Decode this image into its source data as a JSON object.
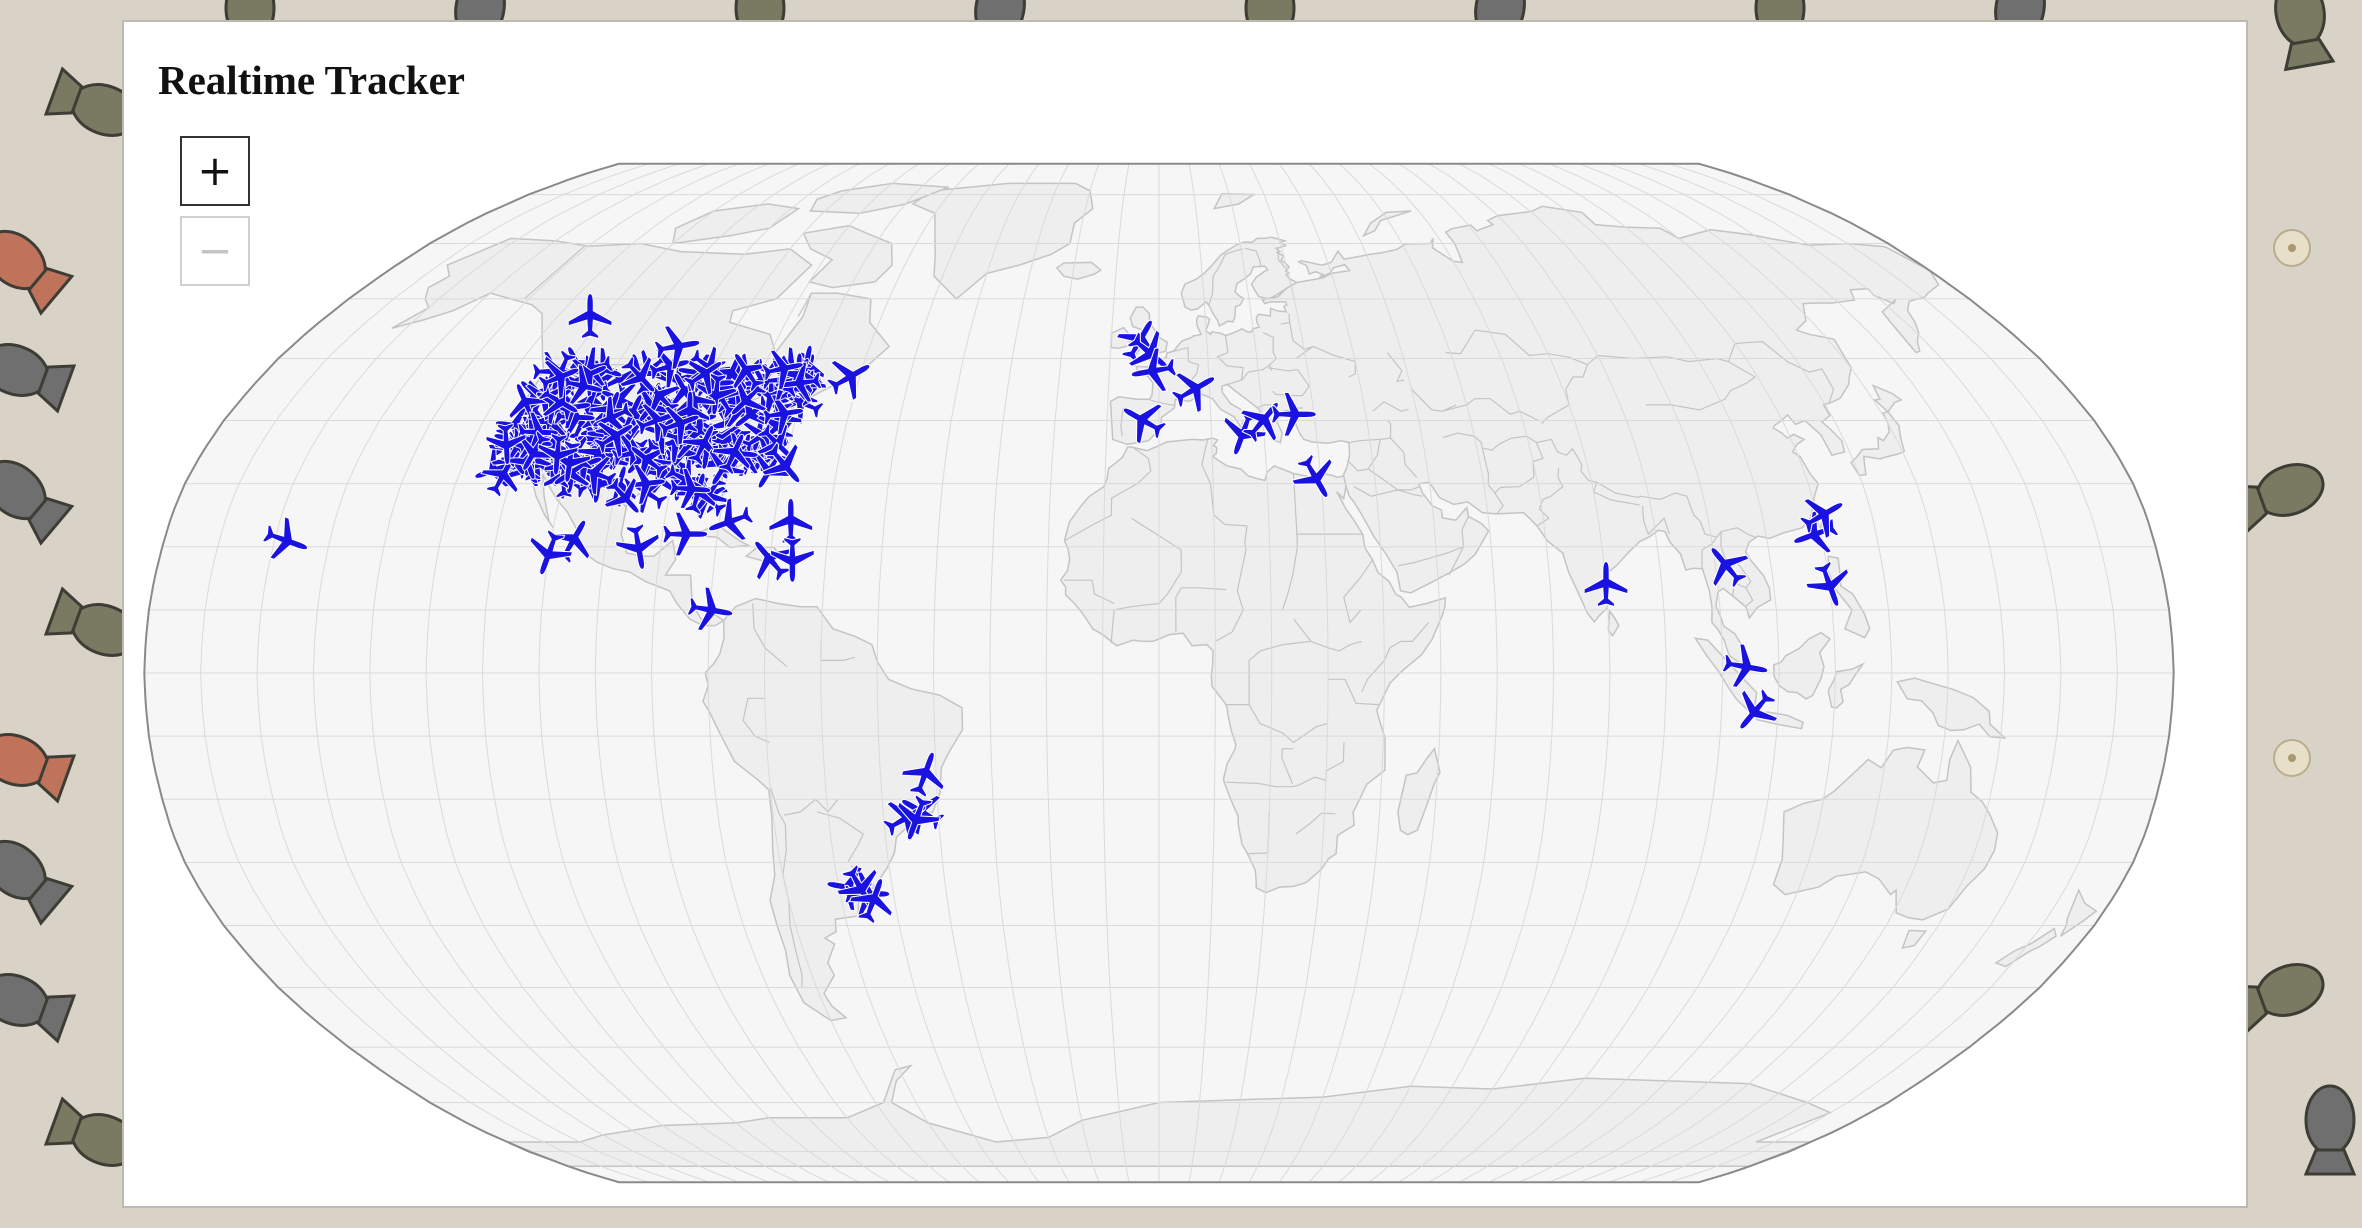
{
  "page": {
    "title": "Realtime Tracker",
    "zoom_in_label": "+",
    "zoom_out_label": "−"
  },
  "icons": {
    "zoom_in": "plus-icon",
    "zoom_out": "minus-icon",
    "aircraft": "airplane-icon",
    "background_pattern": "bomb-icon"
  },
  "map": {
    "projection": "Robinson",
    "graticule_step_deg": 10,
    "show_graticule": true,
    "colors": {
      "ocean": "#f6f6f6",
      "land": "#eeeeee",
      "border": "#c4c4c4",
      "graticule": "#dadada",
      "outline": "#8a8a8a",
      "aircraft": "#1a12e0",
      "page_background": "#d8d3c6",
      "panel": "#ffffff"
    },
    "dense_cluster": {
      "region": "contiguous United States",
      "lon_range": [
        -124,
        -68
      ],
      "lat_range": [
        27,
        49
      ]
    },
    "aircraft": [
      {
        "lon": -123,
        "lat": 57,
        "heading": 0
      },
      {
        "lon": -100,
        "lat": 52,
        "heading": 80
      },
      {
        "lon": -62,
        "lat": 47,
        "heading": 60
      },
      {
        "lon": -158,
        "lat": 21,
        "heading": 110
      },
      {
        "lon": -106,
        "lat": 21,
        "heading": 30
      },
      {
        "lon": -110,
        "lat": 19,
        "heading": 200
      },
      {
        "lon": -94,
        "lat": 20,
        "heading": 170
      },
      {
        "lon": -86,
        "lat": 22,
        "heading": 90
      },
      {
        "lon": -78,
        "lat": 24,
        "heading": 250
      },
      {
        "lon": -67,
        "lat": 24,
        "heading": 0
      },
      {
        "lon": -70,
        "lat": 18,
        "heading": 320
      },
      {
        "lon": -66,
        "lat": 18,
        "heading": 180
      },
      {
        "lon": -70,
        "lat": 33,
        "heading": 140
      },
      {
        "lon": -80,
        "lat": 10,
        "heading": 100
      },
      {
        "lon": -42,
        "lat": -16,
        "heading": 20
      },
      {
        "lon": -43,
        "lat": -22,
        "heading": 300
      },
      {
        "lon": -46,
        "lat": -23,
        "heading": 60
      },
      {
        "lon": -44,
        "lat": -23,
        "heading": 200
      },
      {
        "lon": -58,
        "lat": -34,
        "heading": 280
      },
      {
        "lon": -55,
        "lat": -35,
        "heading": 90
      },
      {
        "lon": -56,
        "lat": -34,
        "heading": 150
      },
      {
        "lon": -54,
        "lat": -36,
        "heading": 20
      },
      {
        "lon": -4,
        "lat": 53,
        "heading": 30
      },
      {
        "lon": -2,
        "lat": 51,
        "heading": 130
      },
      {
        "lon": -1,
        "lat": 48,
        "heading": 260
      },
      {
        "lon": -3,
        "lat": 40,
        "heading": 300
      },
      {
        "lon": 7,
        "lat": 45,
        "heading": 60
      },
      {
        "lon": 16,
        "lat": 38,
        "heading": 200
      },
      {
        "lon": 20,
        "lat": 40,
        "heading": 40
      },
      {
        "lon": 26,
        "lat": 41,
        "heading": 90
      },
      {
        "lon": 29,
        "lat": 31,
        "heading": 150
      },
      {
        "lon": 80,
        "lat": 14,
        "heading": 0
      },
      {
        "lon": 102,
        "lat": 17,
        "heading": 320
      },
      {
        "lon": 104,
        "lat": 1,
        "heading": 100
      },
      {
        "lon": 106,
        "lat": -6,
        "heading": 220
      },
      {
        "lon": 119,
        "lat": 22,
        "heading": 250
      },
      {
        "lon": 121,
        "lat": 25,
        "heading": 60
      },
      {
        "lon": 120,
        "lat": 14,
        "heading": 160
      }
    ]
  }
}
